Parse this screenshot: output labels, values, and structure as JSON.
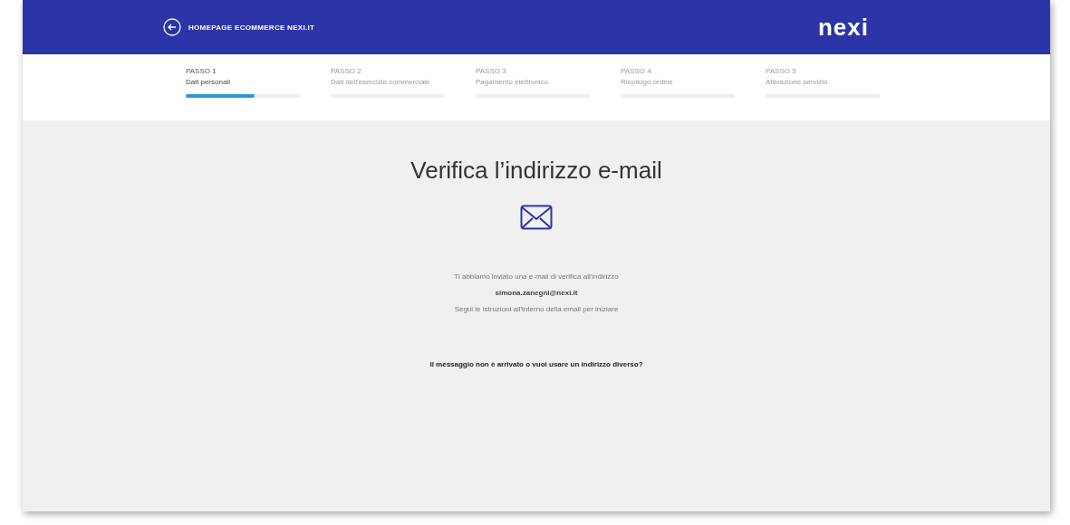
{
  "header": {
    "back_link": "HOMEPAGE ECOMMERCE NEXI.IT",
    "logo": "nexi"
  },
  "steps": [
    {
      "number": "PASSO 1",
      "label": "Dati personali",
      "level": 0.6,
      "selected": true
    },
    {
      "number": "PASSO 2",
      "label": "Dati dell'esercizio commerciale",
      "level": 0,
      "selected": false
    },
    {
      "number": "PASSO 3",
      "label": "Pagamento elettronico",
      "level": 0,
      "selected": false
    },
    {
      "number": "PASSO 4",
      "label": "Riepilogo ordine",
      "level": 0,
      "selected": false
    },
    {
      "number": "PASSO 5",
      "label": "Attivazione servizio",
      "level": 0,
      "selected": false
    }
  ],
  "main": {
    "title": "Verifica l’indirizzo e-mail",
    "message": "Ti abbiamo inviato una e-mail di verifica all'indirizzo",
    "email": "simona.zanegni@nexi.it",
    "instructions": "Segui le istruzioni all'interno della email per iniziare",
    "resend_link": "Il messaggio non è arrivato o vuoi usare un indirizzo diverso?"
  }
}
